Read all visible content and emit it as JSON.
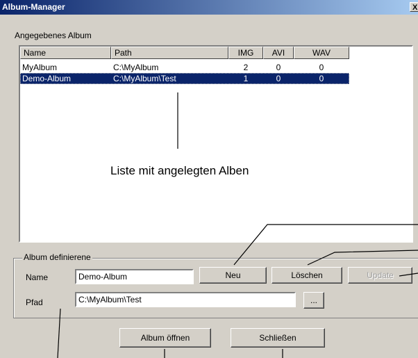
{
  "window": {
    "title": "Album-Manager",
    "close_glyph": "X"
  },
  "list_section": {
    "label": "Angegebenes Album"
  },
  "list": {
    "columns": [
      "Name",
      "Path",
      "IMG",
      "AVI",
      "WAV"
    ],
    "rows": [
      {
        "name": "MyAlbum",
        "path": "C:\\MyAlbum",
        "img": "2",
        "avi": "0",
        "wav": "0",
        "selected": false
      },
      {
        "name": "Demo-Album",
        "path": "C:\\MyAlbum\\Test",
        "img": "1",
        "avi": "0",
        "wav": "0",
        "selected": true
      }
    ]
  },
  "annotation": {
    "list_caption": "Liste mit angelegten Alben"
  },
  "define_group": {
    "legend": "Album definierene",
    "name_label": "Name",
    "name_value": "Demo-Album",
    "path_label": "Pfad",
    "path_value": "C:\\MyAlbum\\Test",
    "browse_label": "...",
    "new_label": "Neu",
    "delete_label": "Löschen",
    "update_label": "Update"
  },
  "footer": {
    "open_label": "Album öffnen",
    "close_label": "Schließen"
  },
  "colors": {
    "titlebar": "#0a246a",
    "selection": "#0a246a",
    "face": "#d4d0c8"
  }
}
